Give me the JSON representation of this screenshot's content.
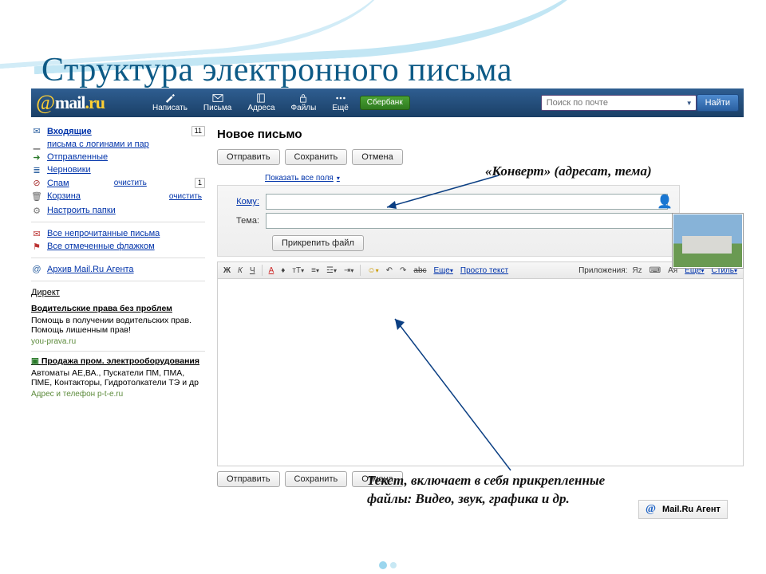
{
  "slide": {
    "title": "Структура электронного письма"
  },
  "header": {
    "logo_at": "@",
    "logo_name": "mail",
    "logo_dot": ".ru",
    "nav": [
      {
        "label": "Написать"
      },
      {
        "label": "Письма"
      },
      {
        "label": "Адреса"
      },
      {
        "label": "Файлы"
      },
      {
        "label": "Ещё"
      }
    ],
    "sberbank": "Сбербанк",
    "search": {
      "placeholder": "Поиск по почте",
      "button": "Найти"
    }
  },
  "sidebar": {
    "inbox": {
      "label": "Входящие",
      "count": "11"
    },
    "logins": {
      "label": "письма с логинами и пар"
    },
    "sent": {
      "label": "Отправленные"
    },
    "drafts": {
      "label": "Черновики"
    },
    "spam": {
      "label": "Спам",
      "clear": "очистить",
      "count": "1"
    },
    "trash": {
      "label": "Корзина",
      "clear": "очистить"
    },
    "settings": {
      "label": "Настроить папки"
    },
    "unread": {
      "label": "Все непрочитанные письма"
    },
    "flagged": {
      "label": "Все отмеченные флажком"
    },
    "archive": {
      "label": "Архив Mail.Ru Агента"
    },
    "direct": {
      "label": "Директ"
    },
    "ad1": {
      "title": "Водительские права без проблем",
      "text": "Помощь в получении водительских прав. Помощь лишенным прав!",
      "url": "you-prava.ru"
    },
    "ad2": {
      "title": "Продажа пром. электрооборудования",
      "text": "Автоматы АЕ,ВА., Пускатели ПМ, ПМА, ПМЕ, Контакторы, Гидротолкатели ТЭ и др",
      "url": "Адрес и телефон  p-t-e.ru"
    }
  },
  "compose": {
    "title": "Новое письмо",
    "buttons": {
      "send": "Отправить",
      "save": "Сохранить",
      "cancel": "Отмена"
    },
    "show_all_fields": "Показать все поля",
    "fields": {
      "to": "Кому:",
      "subject": "Тема:"
    },
    "attach": "Прикрепить файл",
    "toolbar": {
      "bold": "Ж",
      "italic": "К",
      "underline": "Ч",
      "more1": "Еще",
      "plain": "Просто текст",
      "apps": "Приложения:",
      "more2": "Еще",
      "style": "Стиль"
    }
  },
  "annotations": {
    "envelope": "«Конверт» (адресат, тема)",
    "body": "Текст, включает в себя прикрепленные файлы: Видео, звук, графика и др."
  },
  "agent": {
    "at": "@",
    "label": "Mail.Ru Агент"
  }
}
